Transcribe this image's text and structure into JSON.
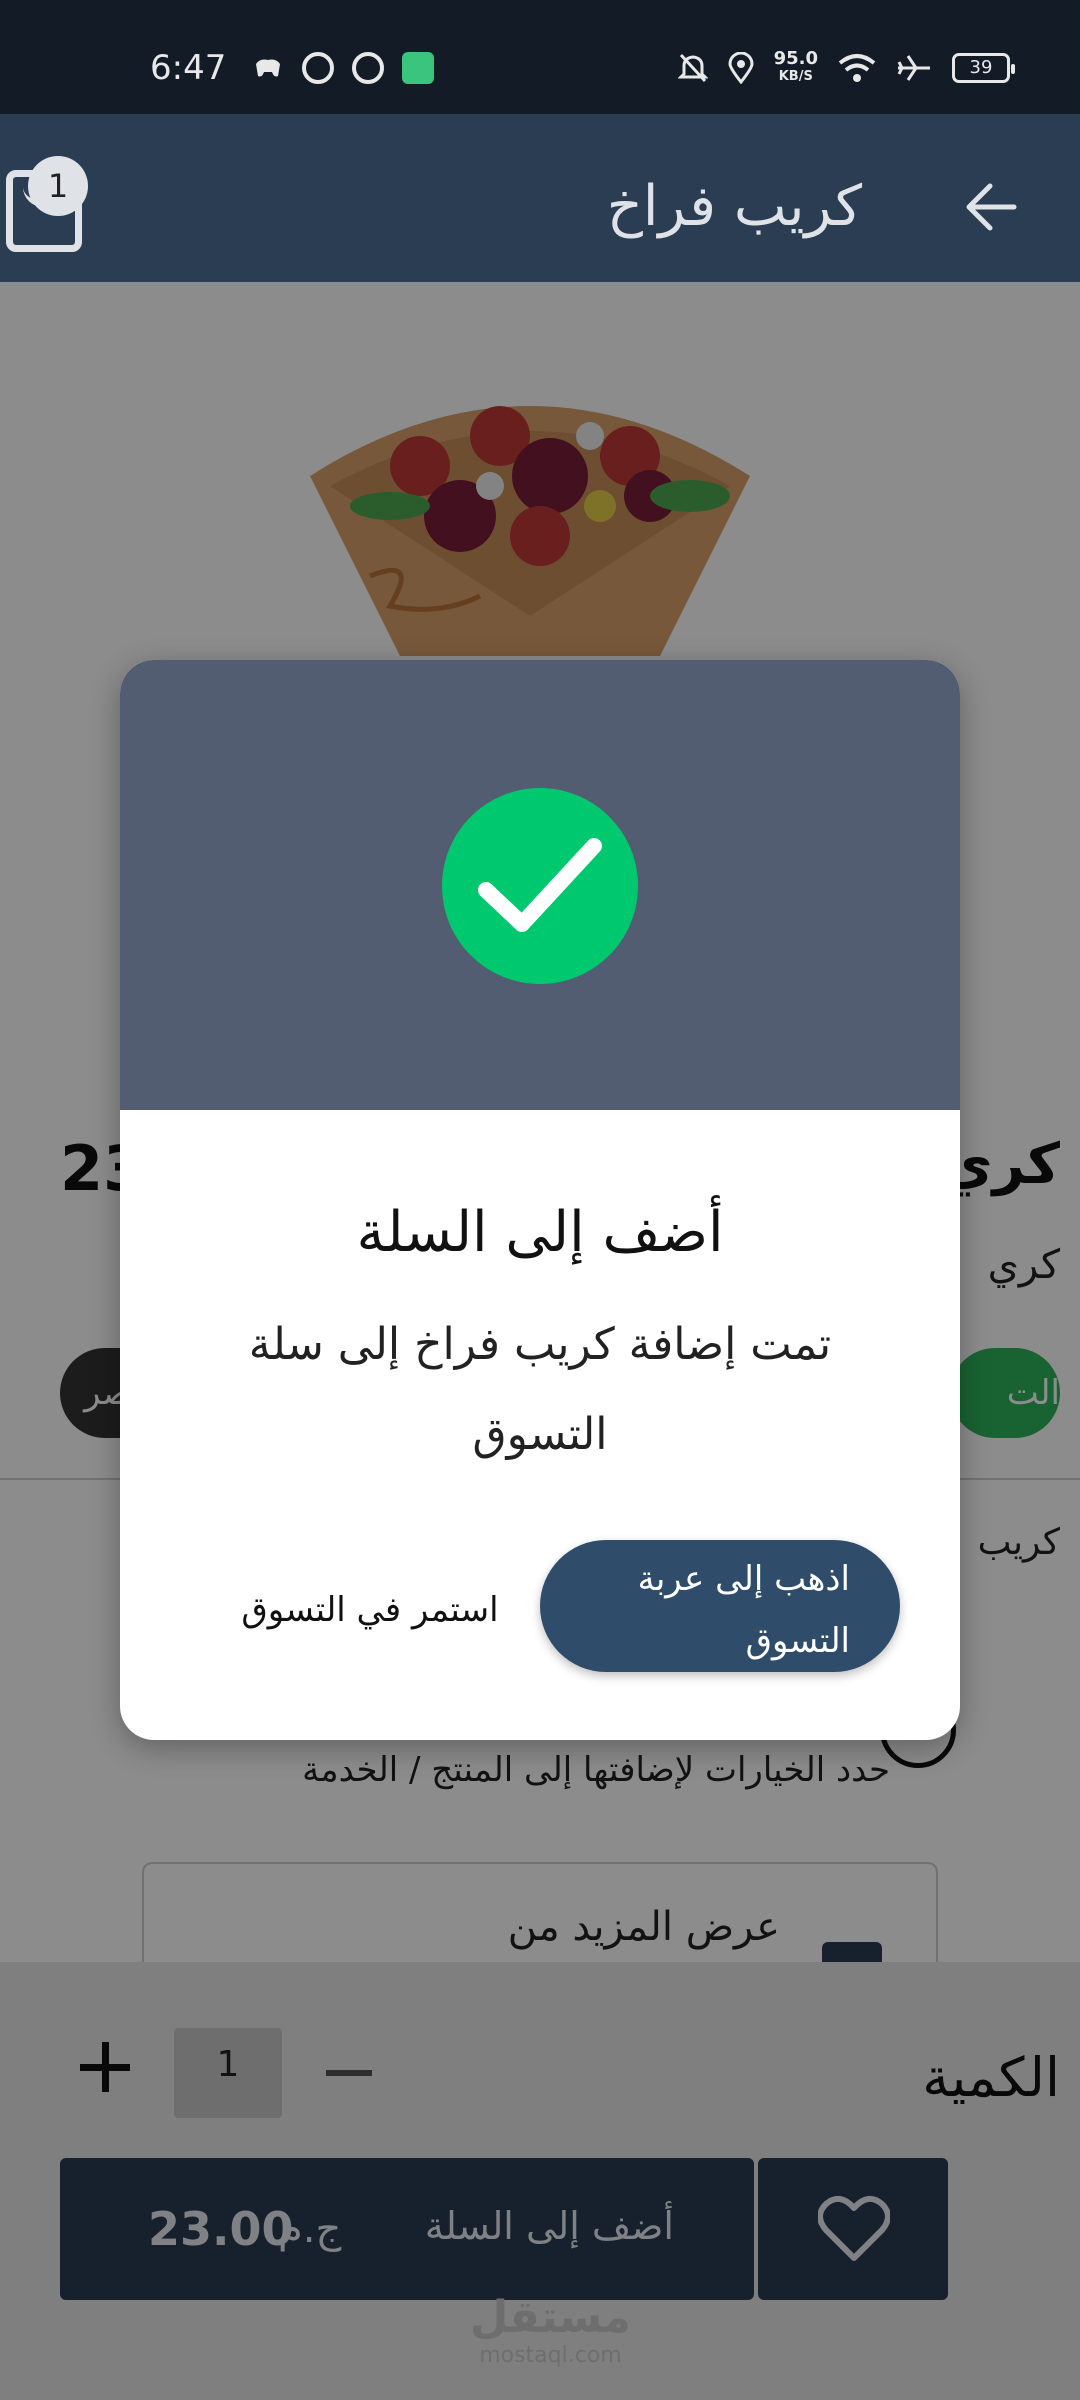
{
  "status_bar": {
    "time": "6:47",
    "speed_value": "95.0",
    "speed_unit": "KB/S",
    "battery": "39"
  },
  "app_bar": {
    "title": "كريب فراخ",
    "cart_count": "1"
  },
  "product": {
    "name_partial": "كري",
    "price_partial": "23",
    "subtitle_partial": "كري",
    "chip_right_partial": "الت",
    "chip_left_partial": "صر",
    "description_partial": "كريب",
    "options_hint": "حدد الخيارات لإضافتها إلى المنتج / الخدمة",
    "show_more": "عرض المزيد من"
  },
  "bottom_bar": {
    "quantity_label": "الكمية",
    "quantity_value": "1",
    "add_to_cart_label": "أضف إلى السلة",
    "price": "23.00",
    "currency": "ج.م"
  },
  "dialog": {
    "title": "أضف إلى السلة",
    "message": "تمت إضافة كريب فراخ إلى سلة التسوق",
    "go_to_cart": "اذهب إلى عربة التسوق",
    "continue_shopping": "استمر في التسوق"
  },
  "watermark": {
    "arabic": "مستقل",
    "latin": "mostaql.com"
  },
  "colors": {
    "app_bar": "#2b3d52",
    "status_bar": "#131b26",
    "dialog_header": "#525d72",
    "success": "#00c86f",
    "primary_button": "#2f4d6b"
  }
}
